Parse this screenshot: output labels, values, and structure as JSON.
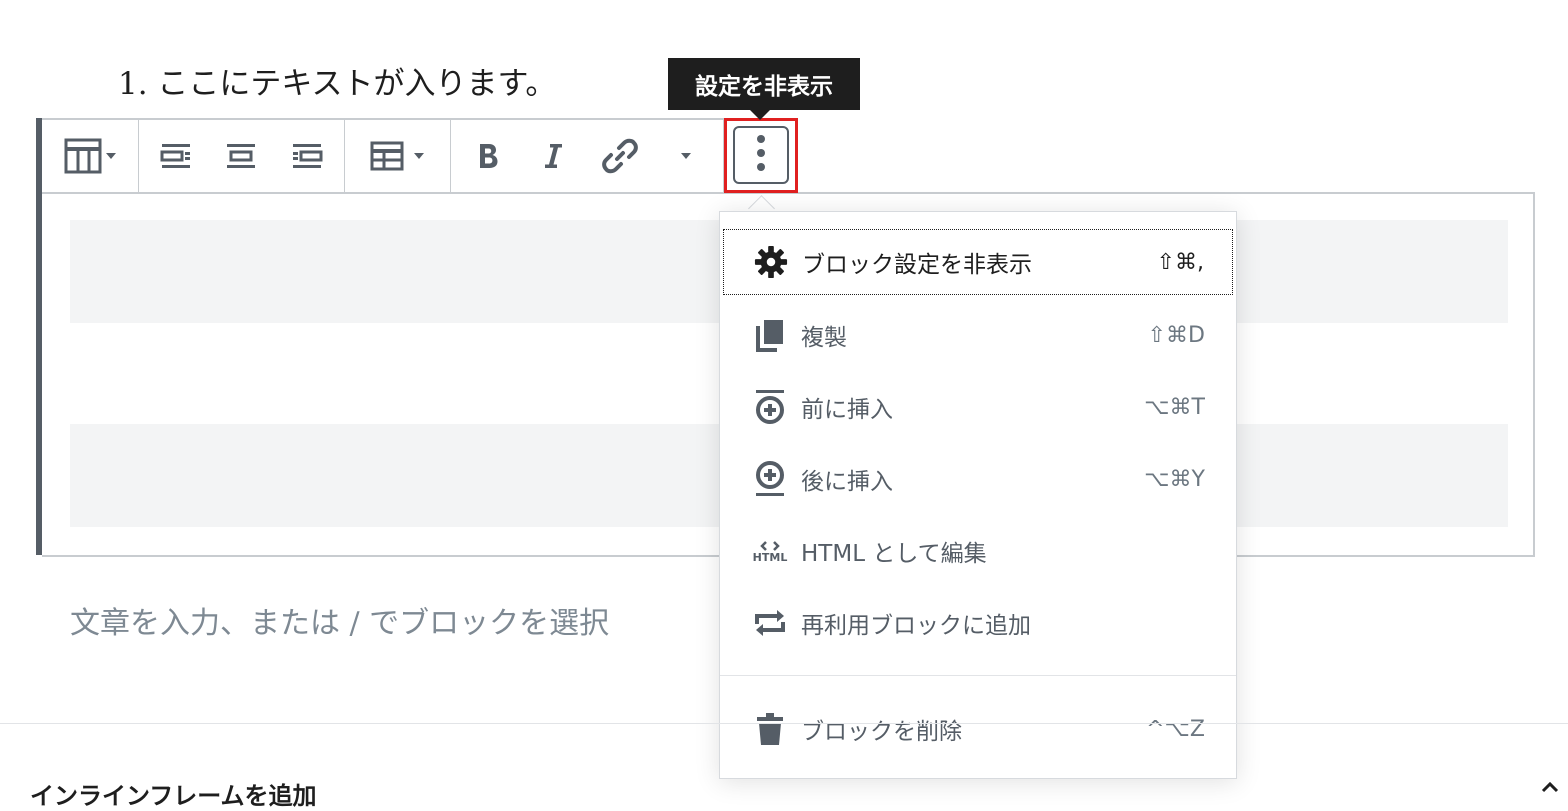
{
  "content": {
    "list_item": "1. ここにテキストが入ります。",
    "placeholder": "文章を入力、または / でブロックを選択",
    "bottom_panel_title": "インラインフレームを追加"
  },
  "tooltip": {
    "text": "設定を非表示"
  },
  "toolbar": {
    "buttons": [
      {
        "name": "table-icon",
        "dropdown": true
      },
      {
        "name": "align-left-icon"
      },
      {
        "name": "align-center-icon"
      },
      {
        "name": "align-right-icon"
      },
      {
        "name": "edit-table-icon",
        "dropdown": true
      },
      {
        "name": "bold-icon"
      },
      {
        "name": "italic-icon"
      },
      {
        "name": "link-icon"
      },
      {
        "name": "more-formatting-chevron-icon"
      },
      {
        "name": "more-options-icon"
      }
    ]
  },
  "menu": {
    "items": [
      {
        "icon": "gear-icon",
        "label": "ブロック設定を非表示",
        "shortcut": "⇧⌘,",
        "focused": true
      },
      {
        "icon": "duplicate-icon",
        "label": "複製",
        "shortcut": "⇧⌘D"
      },
      {
        "icon": "insert-before-icon",
        "label": "前に挿入",
        "shortcut": "⌥⌘T"
      },
      {
        "icon": "insert-after-icon",
        "label": "後に挿入",
        "shortcut": "⌥⌘Y"
      },
      {
        "icon": "html-icon",
        "label": "HTML として編集",
        "shortcut": ""
      },
      {
        "icon": "reusable-block-icon",
        "label": "再利用ブロックに追加",
        "shortcut": ""
      },
      {
        "icon": "trash-icon",
        "label": "ブロックを削除",
        "shortcut": "^⌥Z"
      }
    ],
    "html_icon_text": "HTML"
  },
  "colors": {
    "highlight_border": "#e02020",
    "tooltip_bg": "#1e1e1e",
    "icon_gray": "#555d66",
    "table_row_bg": "#f3f4f5"
  }
}
